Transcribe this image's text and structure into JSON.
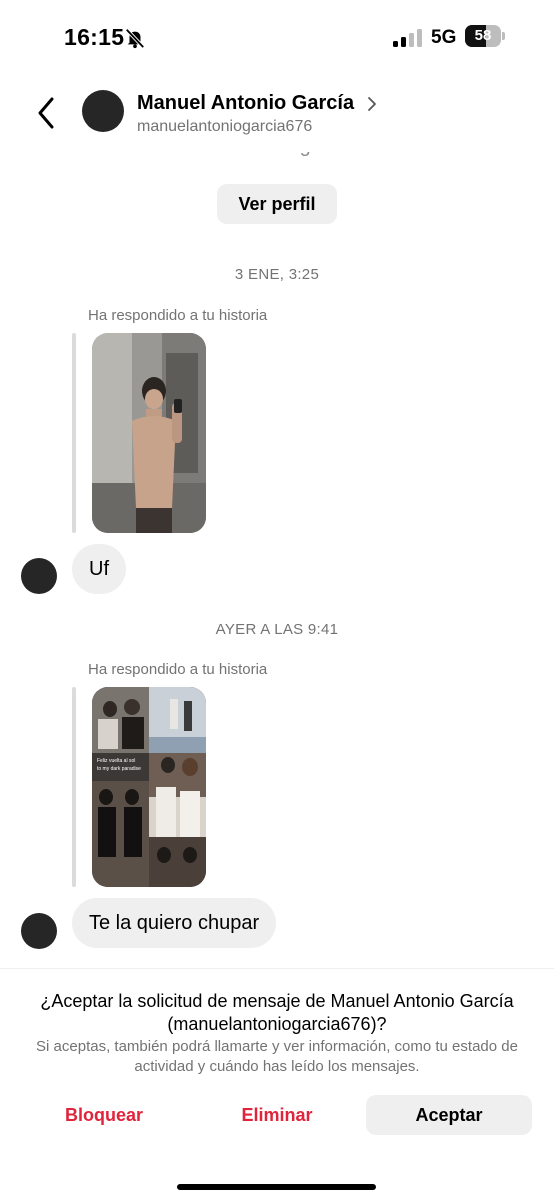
{
  "status_bar": {
    "time": "16:15",
    "network": "5G",
    "battery": "58",
    "battery_level": 0.58
  },
  "header": {
    "name": "Manuel Antonio García",
    "username": "manuelantoniogarcia676"
  },
  "conversation": {
    "top_username": "manuelantoniogarcia676",
    "view_profile": "Ver perfil",
    "items": [
      {
        "timestamp": "3 ENE, 3:25",
        "story_caption": "Ha respondido a tu historia",
        "message": "Uf"
      },
      {
        "timestamp": "AYER A LAS 9:41",
        "story_caption": "Ha respondido a tu historia",
        "story_overlay_text": "Feliz vuelta al sol to my dark paradise",
        "message": "Te la quiero chupar"
      }
    ]
  },
  "request": {
    "title": "¿Aceptar la solicitud de mensaje de Manuel Antonio García (manuelantoniogarcia676)?",
    "description": "Si aceptas, también podrá llamarte y ver información, como tu estado de actividad y cuándo has leído los mensajes.",
    "block": "Bloquear",
    "delete": "Eliminar",
    "accept": "Aceptar"
  },
  "icons": [
    "bell-off-icon",
    "signal-icon",
    "battery-icon",
    "back-icon",
    "chevron-right-icon"
  ]
}
